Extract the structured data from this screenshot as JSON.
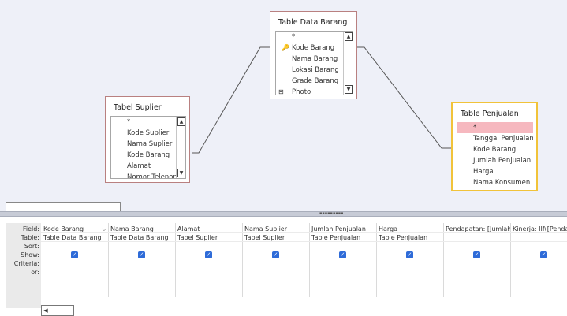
{
  "tables": {
    "data_barang": {
      "title": "Table Data Barang",
      "fields": [
        "*",
        "Kode Barang",
        "Nama Barang",
        "Lokasi Barang",
        "Grade Barang",
        "Photo"
      ]
    },
    "suplier": {
      "title": "Tabel Suplier",
      "fields": [
        "*",
        "Kode Suplier",
        "Nama Suplier",
        "Kode Barang",
        "Alamat",
        "Nomor Telepon"
      ]
    },
    "penjualan": {
      "title": "Table Penjualan",
      "fields": [
        "*",
        "Tanggal Penjualan",
        "Kode Barang",
        "Jumlah Penjualan",
        "Harga",
        "Nama Konsumen"
      ]
    }
  },
  "grid": {
    "row_labels": [
      "Field:",
      "Table:",
      "Sort:",
      "Show:",
      "Criteria:",
      "or:"
    ],
    "columns": [
      {
        "field": "Kode Barang",
        "table": "Table Data Barang",
        "show": true
      },
      {
        "field": "Nama Barang",
        "table": "Table Data Barang",
        "show": true
      },
      {
        "field": "Alamat",
        "table": "Tabel Suplier",
        "show": true
      },
      {
        "field": "Nama Suplier",
        "table": "Tabel Suplier",
        "show": true
      },
      {
        "field": "Jumlah Penjualan",
        "table": "Table Penjualan",
        "show": true
      },
      {
        "field": "Harga",
        "table": "Table Penjualan",
        "show": true
      },
      {
        "field": "Pendapatan: [Jumlah",
        "table": "",
        "show": true
      },
      {
        "field": "Kinerja: IIf([Pendapa",
        "table": "",
        "show": true
      }
    ]
  },
  "colors": {
    "design_bg": "#eef0f8",
    "table_border": "#b98080",
    "selected_border": "#f1c33a",
    "highlight_row": "#f6b8bf",
    "checkbox": "#2e6bd8"
  }
}
